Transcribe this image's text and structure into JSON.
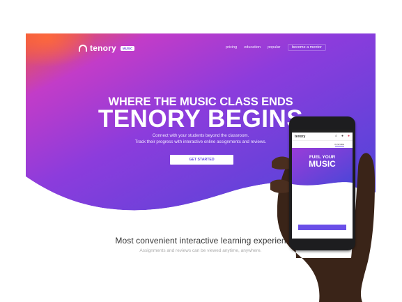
{
  "site": {
    "logo_text": "tenory",
    "logo_badge": "music",
    "nav": [
      "pricing",
      "education",
      "popular"
    ],
    "mentor_button": "become a mentor",
    "headline": "WHERE THE MUSIC CLASS ENDS",
    "headline_big": "TENORY BEGINS",
    "subline_1": "Connect with your students beyond the classroom.",
    "subline_2": "Track their progress with interactive online assignments and reviews.",
    "cta": "GET STARTED",
    "section_title": "Most convenient interactive learning experien",
    "section_sub": "Assignments and reviews can be viewed anytime, anywhere."
  },
  "phone": {
    "logo_text": "tenory",
    "tabs": [
      "",
      "",
      "IN STORE"
    ],
    "headline": "FUEL YOUR",
    "headline_big": "MUSIC",
    "hero_sub": "",
    "message": "",
    "button": ""
  },
  "colors": {
    "gradient_orange": "#f05a35",
    "gradient_magenta": "#c23cc8",
    "gradient_purple": "#8c3cdc",
    "gradient_blue": "#4a46d8",
    "cta_text": "#6a4fe8",
    "skin": "#3a2418"
  }
}
